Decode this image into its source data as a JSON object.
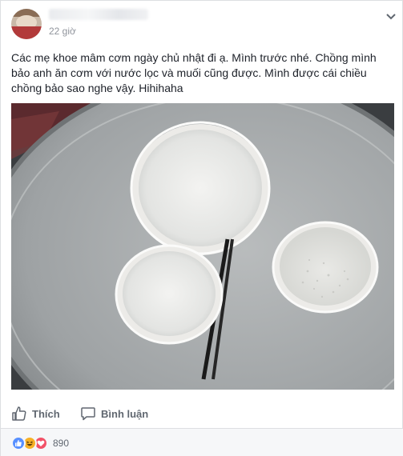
{
  "post": {
    "time": "22 giờ",
    "text": "Các mẹ khoe mâm cơm ngày chủ nhật đi ạ. Mình trước nhé. Chồng mình bảo anh ăn cơm với nước lọc và muối cũng được. Mình được cái chiều chồng bảo sao nghe vậy. Hihihaha"
  },
  "actions": {
    "like_label": "Thích",
    "comment_label": "Bình luận"
  },
  "reactions": {
    "types": [
      "like",
      "haha",
      "love"
    ],
    "count": "890"
  },
  "icons": {
    "menu": "chevron-down-icon",
    "like": "thumbs-up-icon",
    "comment": "speech-bubble-icon"
  },
  "colors": {
    "like_blue": "#5890ff",
    "haha_yellow": "#f7b125",
    "love_red": "#f25268",
    "secondary_text": "#606770"
  }
}
